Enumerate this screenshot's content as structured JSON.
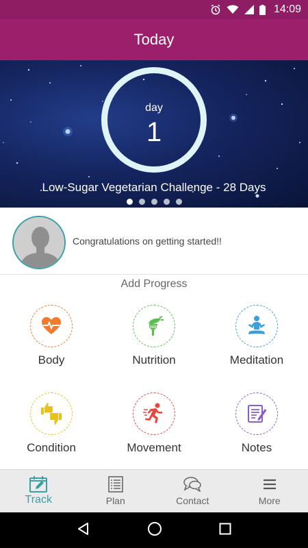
{
  "status_bar": {
    "time": "14:09"
  },
  "app_bar": {
    "title": "Today"
  },
  "hero": {
    "day_label": "day",
    "day_number": "1",
    "challenge_title": "Low-Sugar Vegetarian Challenge - 28 Days",
    "pager_count": 5,
    "pager_active": 0
  },
  "welcome": {
    "message": "Congratulations on getting started!!"
  },
  "progress": {
    "title": "Add Progress",
    "items": [
      {
        "label": "Body",
        "icon": "heart-pulse-icon",
        "color": "#f07a2e"
      },
      {
        "label": "Nutrition",
        "icon": "fork-veggie-icon",
        "color": "#5bbf4f"
      },
      {
        "label": "Meditation",
        "icon": "meditation-icon",
        "color": "#3d9fd8"
      },
      {
        "label": "Condition",
        "icon": "thumbs-icon",
        "color": "#e8c21b"
      },
      {
        "label": "Movement",
        "icon": "running-icon",
        "color": "#e8473f"
      },
      {
        "label": "Notes",
        "icon": "notes-icon",
        "color": "#8a5cc7"
      }
    ]
  },
  "bottom_nav": {
    "items": [
      {
        "label": "Track",
        "icon": "calendar-edit-icon"
      },
      {
        "label": "Plan",
        "icon": "list-icon"
      },
      {
        "label": "Contact",
        "icon": "chat-icon"
      },
      {
        "label": "More",
        "icon": "menu-icon"
      }
    ],
    "active": "Track",
    "accent": "#3aa0a6"
  },
  "colors": {
    "app_bar": "#9c1f6b",
    "status_bar": "#8e1d63",
    "ring": "#dff4f6"
  }
}
